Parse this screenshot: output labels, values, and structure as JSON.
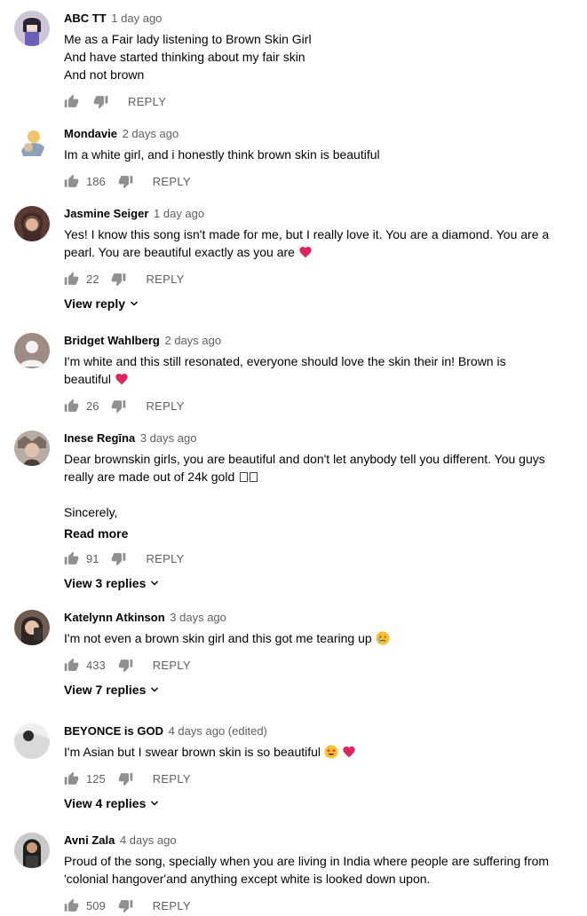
{
  "comments": [
    {
      "author": "ABC TT",
      "time": "1 day ago",
      "lines": [
        "Me as a Fair lady listening to Brown Skin Girl",
        "And have started thinking about my fair skin",
        "And not brown"
      ],
      "likes": "",
      "reply_label": "REPLY"
    },
    {
      "author": "Mondavie",
      "time": "2 days ago",
      "lines": [
        "Im a white girl, and i honestly think brown skin is beautiful"
      ],
      "likes": "186",
      "reply_label": "REPLY"
    },
    {
      "author": "Jasmine Seiger",
      "time": "1 day ago",
      "lines": [
        "Yes! I know this song isn't made for me, but I really love it. You are a diamond. You are a",
        "pearl. You are beautiful exactly as you are"
      ],
      "likes": "22",
      "reply_label": "REPLY",
      "view_replies": "View reply"
    },
    {
      "author": "Bridget Wahlberg",
      "time": "2 days ago",
      "lines": [
        "I'm white and this still resonated, everyone should love the skin their in! Brown is",
        "beautiful"
      ],
      "likes": "26",
      "reply_label": "REPLY"
    },
    {
      "author": "Inese Regīna",
      "time": "3 days ago",
      "lines": [
        "Dear brownskin girls, you are beautiful and don't let anybody tell you different. You guys",
        "really are made out of 24k gold",
        "",
        "Sincerely,"
      ],
      "read_more": "Read more",
      "likes": "91",
      "reply_label": "REPLY",
      "view_replies": "View 3 replies"
    },
    {
      "author": "Katelynn Atkinson",
      "time": "3 days ago",
      "lines": [
        "I'm not even a brown skin girl and this got me tearing up"
      ],
      "likes": "433",
      "reply_label": "REPLY",
      "view_replies": "View 7 replies"
    },
    {
      "author": "BEYONCE is GOD",
      "time": "4 days ago (edited)",
      "lines": [
        "I'm Asian but I swear brown skin is so beautiful"
      ],
      "likes": "125",
      "reply_label": "REPLY",
      "view_replies": "View 4 replies"
    },
    {
      "author": "Avni Zala",
      "time": "4 days ago",
      "lines": [
        "Proud of the song, specially when you are living in India where people are suffering from",
        "'colonial hangover'and anything except white is looked down upon."
      ],
      "likes": "509",
      "reply_label": "REPLY"
    }
  ],
  "colors": {
    "text": "#030303",
    "secondary": "#606060",
    "icon": "#909090",
    "heart": "#e0245e"
  }
}
